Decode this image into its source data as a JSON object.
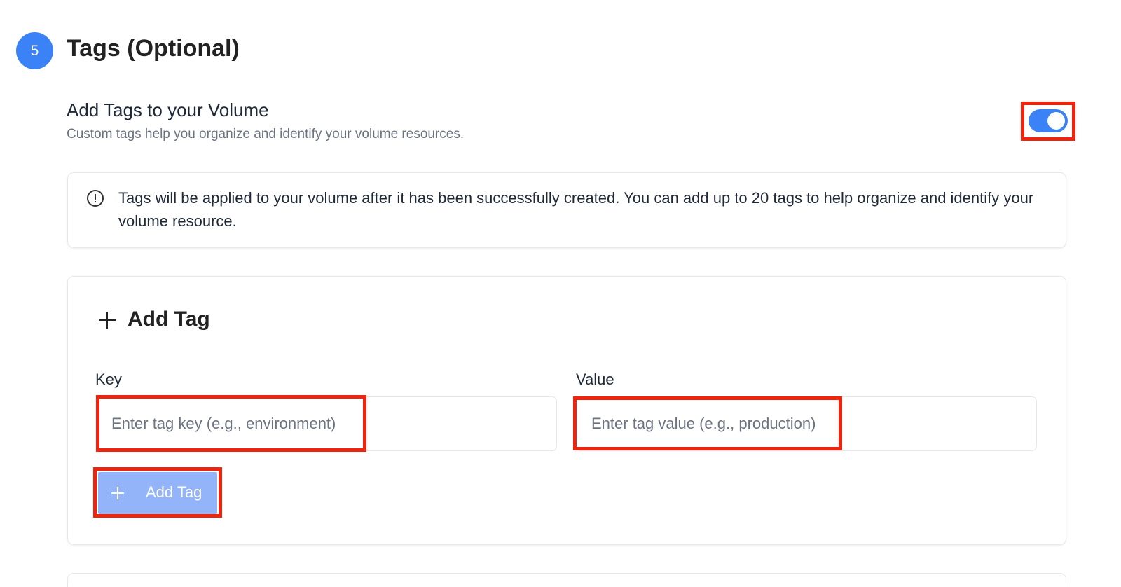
{
  "section": {
    "step_number": "5",
    "title": "Tags (Optional)"
  },
  "toggle": {
    "heading": "Add Tags to your Volume",
    "description": "Custom tags help you organize and identify your volume resources.",
    "enabled": true
  },
  "info": {
    "icon": "info-circle-icon",
    "text": "Tags will be applied to your volume after it has been successfully created. You can add up to 20 tags to help organize and identify your volume resource."
  },
  "tag_card": {
    "title": "Add Tag",
    "title_icon": "plus-icon",
    "key_label": "Key",
    "key_placeholder": "Enter tag key (e.g., environment)",
    "key_value": "",
    "value_label": "Value",
    "value_placeholder": "Enter tag value (e.g., production)",
    "value_value": "",
    "add_button_label": "Add Tag",
    "add_button_icon": "plus-icon"
  },
  "colors": {
    "accent": "#3b82f6",
    "button_disabled": "#93b4f8",
    "annotation": "#f0230f",
    "muted_text": "#6b7280",
    "border": "#e5e7eb"
  }
}
